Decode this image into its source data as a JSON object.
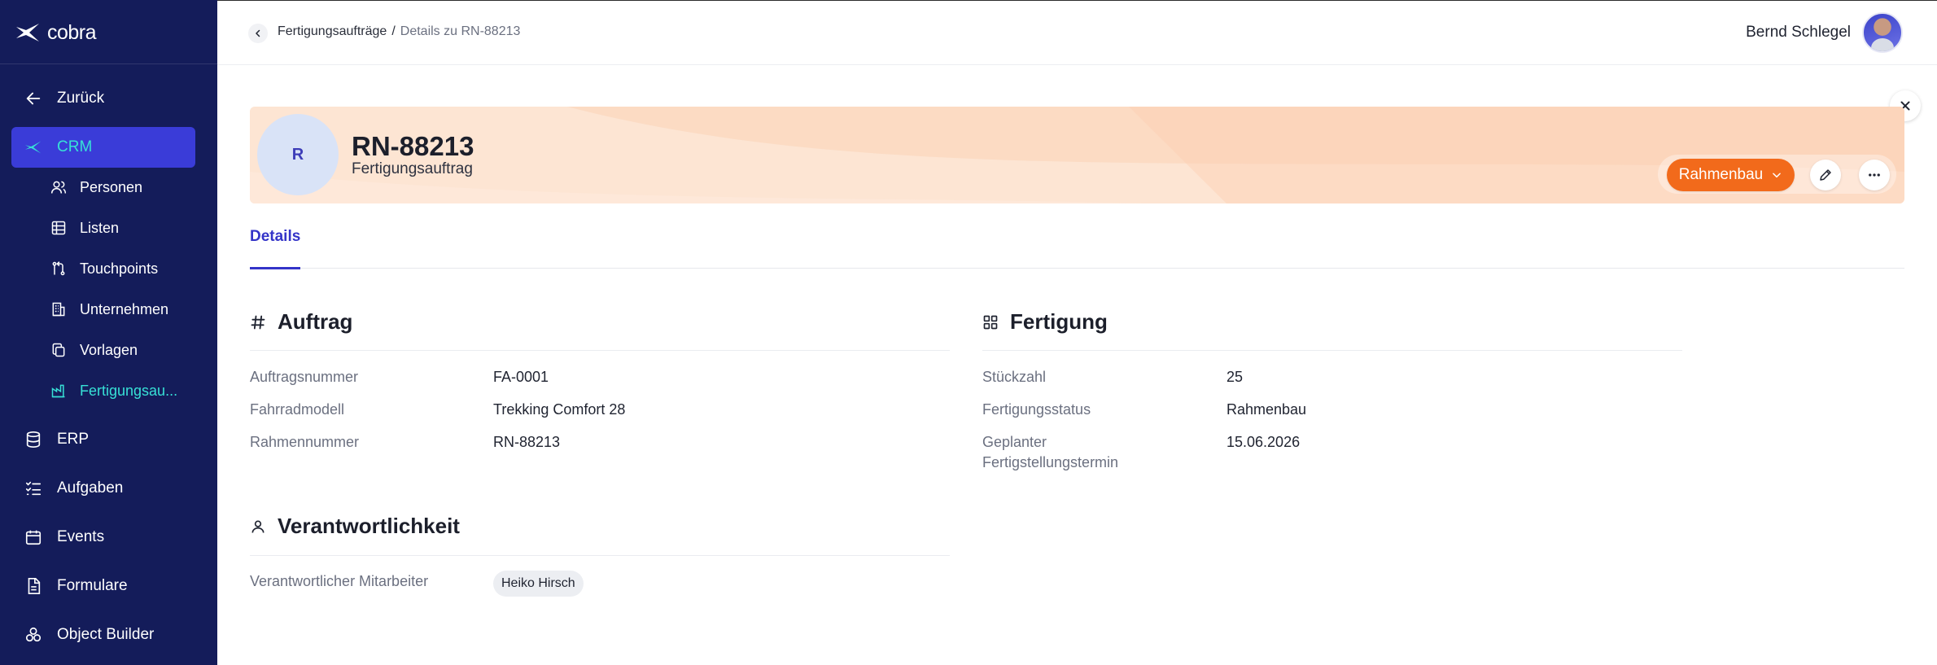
{
  "app": {
    "brand": "cobra",
    "colors": {
      "sidebar": "#141c5a",
      "active_bg": "#3a3cd8",
      "active_text": "#37e0d6",
      "accent": "#3434c8",
      "status": "#f26a1b",
      "banner": "#fde5d3"
    }
  },
  "sidebar": {
    "back_label": "Zurück",
    "items": [
      {
        "label": "CRM",
        "icon": "crm-bird-icon",
        "active": true
      },
      {
        "label": "ERP",
        "icon": "database-icon"
      },
      {
        "label": "Aufgaben",
        "icon": "task-list-icon"
      },
      {
        "label": "Events",
        "icon": "calendar-icon"
      },
      {
        "label": "Formulare",
        "icon": "form-icon"
      },
      {
        "label": "Object Builder",
        "icon": "object-builder-icon"
      }
    ],
    "crm_sub": [
      {
        "label": "Personen",
        "icon": "people-icon"
      },
      {
        "label": "Listen",
        "icon": "table-icon"
      },
      {
        "label": "Touchpoints",
        "icon": "touchpoint-icon"
      },
      {
        "label": "Unternehmen",
        "icon": "building-icon"
      },
      {
        "label": "Vorlagen",
        "icon": "copy-icon"
      },
      {
        "label": "Fertigungsau...",
        "icon": "factory-icon",
        "active": true
      }
    ]
  },
  "topbar": {
    "breadcrumb": {
      "parent": "Fertigungsaufträge",
      "separator": "/",
      "current": "Details zu RN-88213"
    },
    "user_name": "Bernd Schlegel"
  },
  "record": {
    "avatar_letter": "R",
    "title": "RN-88213",
    "subtitle": "Fertigungsauftrag",
    "status": "Rahmenbau"
  },
  "tabs": [
    {
      "label": "Details",
      "active": true
    }
  ],
  "sections": {
    "auftrag": {
      "title": "Auftrag",
      "fields": [
        {
          "label": "Auftragsnummer",
          "value": "FA-0001"
        },
        {
          "label": "Fahrradmodell",
          "value": "Trekking Comfort 28"
        },
        {
          "label": "Rahmennummer",
          "value": "RN-88213"
        }
      ]
    },
    "fertigung": {
      "title": "Fertigung",
      "fields": [
        {
          "label": "Stückzahl",
          "value": "25"
        },
        {
          "label": "Fertigungsstatus",
          "value": "Rahmenbau"
        },
        {
          "label": "Geplanter Fertigstellungstermin",
          "value": "15.06.2026"
        }
      ]
    },
    "verantwortlichkeit": {
      "title": "Verantwortlichkeit",
      "fields": [
        {
          "label": "Verantwortlicher Mitarbeiter",
          "value": "Heiko Hirsch"
        }
      ]
    }
  }
}
